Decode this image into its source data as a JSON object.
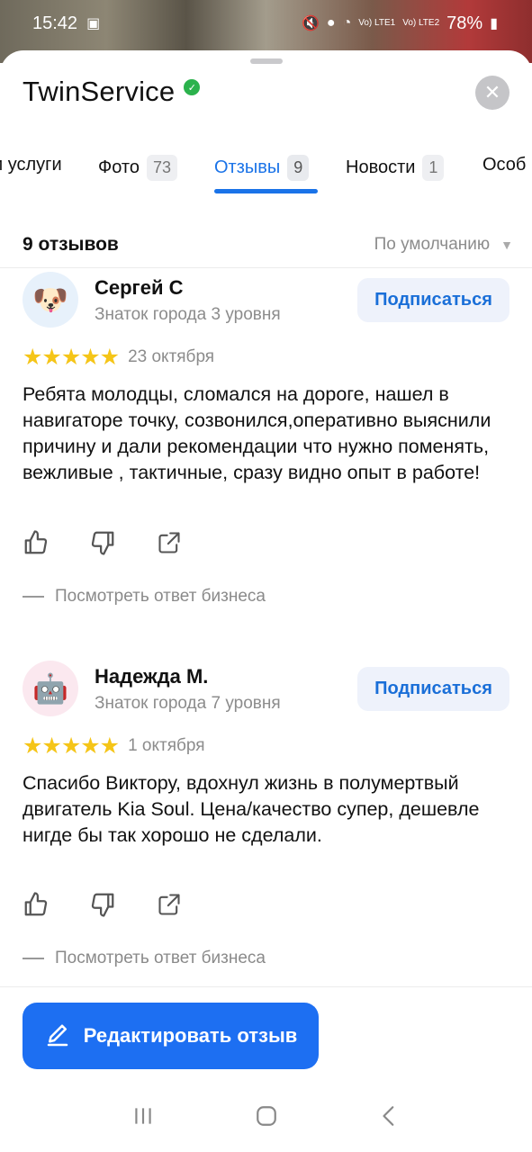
{
  "status_bar": {
    "time": "15:42",
    "battery": "78%",
    "signal1": "Vo) LTE1",
    "signal2": "Vo) LTE2"
  },
  "header": {
    "title": "TwinService",
    "close_icon": "close-icon"
  },
  "tabs": [
    {
      "label": "и услуги",
      "count": ""
    },
    {
      "label": "Фото",
      "count": "73"
    },
    {
      "label": "Отзывы",
      "count": "9",
      "active": true
    },
    {
      "label": "Новости",
      "count": "1"
    },
    {
      "label": "Особ",
      "count": ""
    }
  ],
  "reviews_summary": {
    "count_label": "9 отзывов",
    "sort_label": "По умолчанию"
  },
  "reviews": [
    {
      "author": "Сергей С",
      "level": "Знаток города 3 уровня",
      "subscribe_label": "Подписаться",
      "rating": 5,
      "stars": "★★★★★",
      "date": "23 октября",
      "text": "Ребята молодцы, сломался на дороге, нашел в навигаторе точку, созвонился,оперативно выяснили причину и дали рекомендации что нужно поменять, вежливые , тактичные, сразу видно опыт в работе!",
      "business_reply_label": "Посмотреть ответ бизнеса",
      "avatar_icon": "dog-avatar-icon"
    },
    {
      "author": "Надежда М.",
      "level": "Знаток города 7 уровня",
      "subscribe_label": "Подписаться",
      "rating": 5,
      "stars": "★★★★★",
      "date": "1 октября",
      "text": "Спасибо Виктору, вдохнул жизнь в полумертвый двигатель Kia Soul. Цена/качество супер, дешевле нигде бы так хорошо не сделали.",
      "business_reply_label": "Посмотреть ответ бизнеса",
      "avatar_icon": "robot-avatar-icon"
    }
  ],
  "edit_button": {
    "label": "Редактировать отзыв"
  },
  "colors": {
    "accent": "#1a73e8",
    "primary_button": "#1d6ff2",
    "star": "#f5c518",
    "verified": "#2bb24c"
  }
}
